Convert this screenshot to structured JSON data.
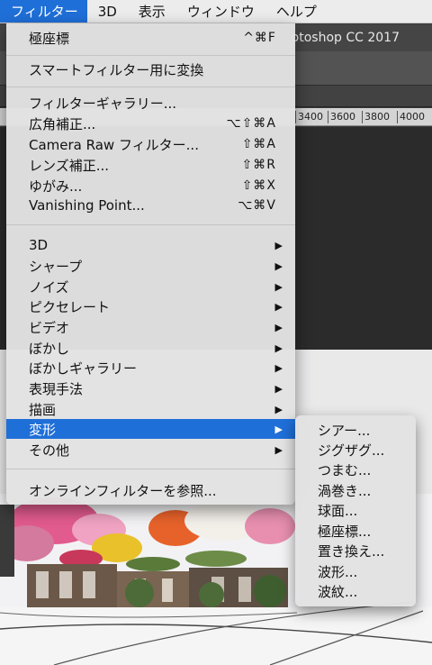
{
  "menubar": {
    "items": [
      {
        "label": "フィルター",
        "active": true
      },
      {
        "label": "3D",
        "active": false
      },
      {
        "label": "表示",
        "active": false
      },
      {
        "label": "ウィンドウ",
        "active": false
      },
      {
        "label": "ヘルプ",
        "active": false
      }
    ]
  },
  "app": {
    "title_fragment": "otoshop CC 2017",
    "ruler_labels": [
      "3400",
      "3600",
      "3800",
      "4000"
    ]
  },
  "filter_menu": {
    "last_filter": {
      "label": "極座標",
      "shortcut": "^⌘F"
    },
    "convert_smart": {
      "label": "スマートフィルター用に変換"
    },
    "gallery": {
      "label": "フィルターギャラリー..."
    },
    "adaptive_wide": {
      "label": "広角補正...",
      "shortcut": "⌥⇧⌘A"
    },
    "camera_raw": {
      "label": "Camera Raw フィルター...",
      "shortcut": "⇧⌘A"
    },
    "lens": {
      "label": "レンズ補正...",
      "shortcut": "⇧⌘R"
    },
    "liquify": {
      "label": "ゆがみ...",
      "shortcut": "⇧⌘X"
    },
    "vanishing": {
      "label": "Vanishing Point...",
      "shortcut": "⌥⌘V"
    },
    "groups": {
      "g3d": "3D",
      "sharpen": "シャープ",
      "noise": "ノイズ",
      "pixelate": "ピクセレート",
      "video": "ビデオ",
      "blur": "ぼかし",
      "blur_gallery": "ぼかしギャラリー",
      "stylize": "表現手法",
      "render": "描画",
      "distort": "変形",
      "other": "その他"
    },
    "online": {
      "label": "オンラインフィルターを参照..."
    }
  },
  "distort_submenu": {
    "items": [
      "シアー...",
      "ジグザグ...",
      "つまむ...",
      "渦巻き...",
      "球面...",
      "極座標...",
      "置き換え...",
      "波形...",
      "波紋..."
    ]
  }
}
